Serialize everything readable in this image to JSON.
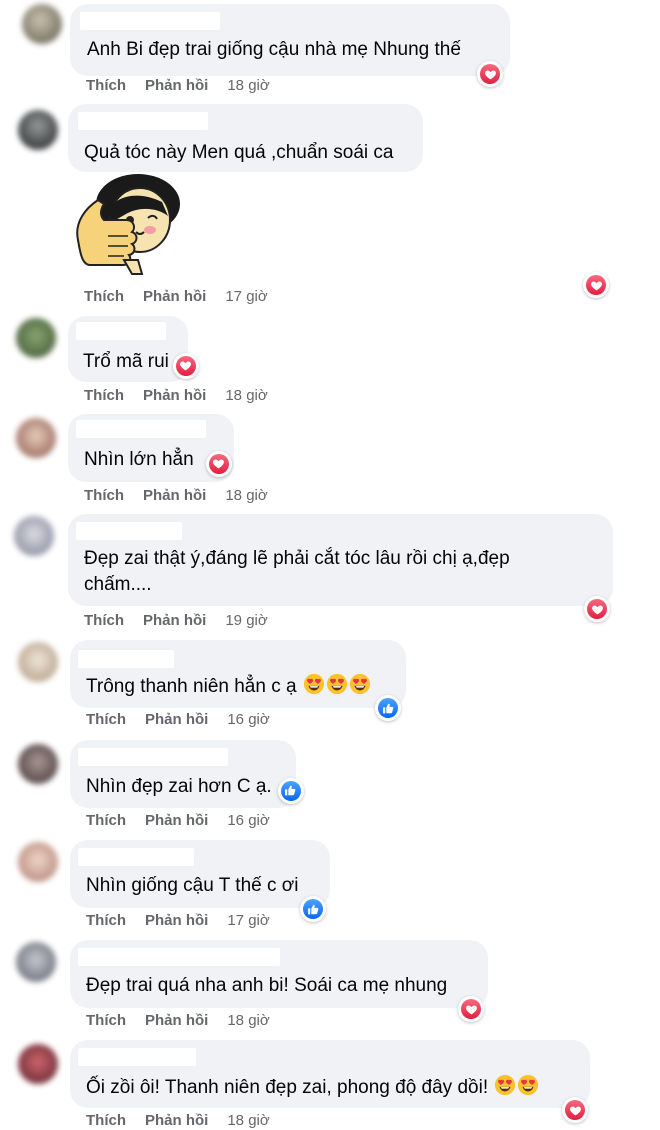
{
  "actions": {
    "like": "Thích",
    "reply": "Phản hồi"
  },
  "comments": [
    {
      "text": "Anh Bi đẹp trai giống cậu nhà mẹ Nhung thế",
      "time": "18 giờ",
      "reaction": "heart-icon"
    },
    {
      "text": "Quả tóc này Men quá ,chuẩn soái ca",
      "sticker": "thumbs-up-girl-sticker",
      "time": "17 giờ",
      "reaction": "heart-icon"
    },
    {
      "text": "Trổ mã rui",
      "time": "18 giờ",
      "reaction": "heart-icon"
    },
    {
      "text": "Nhìn lớn hẳn",
      "time": "18 giờ",
      "reaction": "heart-icon"
    },
    {
      "text_line1": "Đẹp zai thật ý,đáng lẽ phải cắt tóc lâu rồi chị ạ,đẹp",
      "text_line2": "chấm....",
      "time": "19 giờ",
      "reaction": "heart-icon"
    },
    {
      "text": "Trông thanh niên hẳn c ạ",
      "emojis": "heart-eyes-emoji x3",
      "time": "16 giờ",
      "reaction": "like-icon"
    },
    {
      "text": "Nhìn đẹp zai hơn C ạ.",
      "time": "16 giờ",
      "reaction": "like-icon"
    },
    {
      "text": "Nhìn giống cậu T thế c ơi",
      "time": "17 giờ",
      "reaction": "like-icon"
    },
    {
      "text": "Đẹp trai quá nha anh bi! Soái ca mẹ nhung",
      "time": "18 giờ",
      "reaction": "heart-icon"
    },
    {
      "text": "Ối zồi ôi! Thanh niên đẹp zai, phong độ đây dồi!",
      "emojis": "heart-eyes-emoji x2",
      "time": "18 giờ",
      "reaction": "heart-icon"
    }
  ],
  "colors": {
    "bubble": "#f0f2f5",
    "action_text": "#65676b",
    "heart": "#e41e3f",
    "like": "#0866ff"
  }
}
